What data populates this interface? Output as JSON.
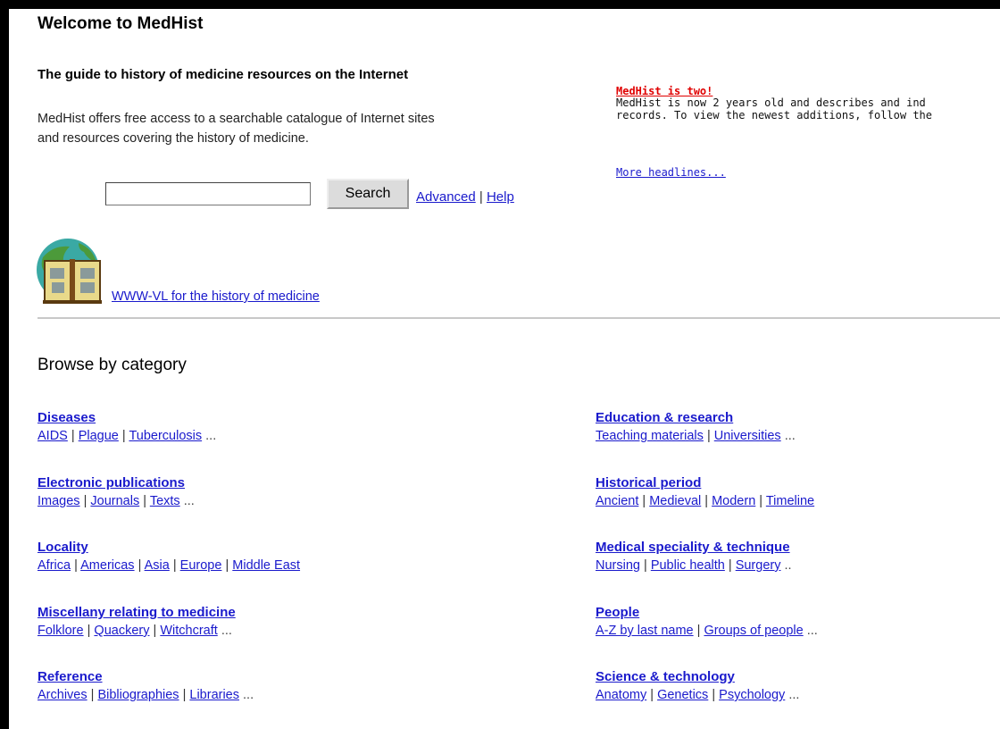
{
  "page": {
    "title": "Welcome to MedHist",
    "tagline": "The guide to history of medicine resources on the Internet",
    "intro_line1": "MedHist offers free access to a searchable catalogue of Internet sites",
    "intro_line2": "and resources covering the history of medicine."
  },
  "search": {
    "value": "",
    "placeholder": "",
    "button_label": "Search",
    "advanced_label": "Advanced",
    "help_label": "Help",
    "separator": "|"
  },
  "vl": {
    "link_label": "WWW-VL for the history of medicine",
    "logo_icon": "open-book-globe-icon"
  },
  "news": {
    "headline": "MedHist is two!",
    "body_line1": "MedHist is now 2 years old and describes and ind",
    "body_line2": "records. To view the newest additions, follow the",
    "more_label": "More headlines..."
  },
  "browse": {
    "title": "Browse by category",
    "separator": "|",
    "ellipsis": "...",
    "short_ellipsis": "..",
    "diseases": {
      "name": "Diseases",
      "subs": [
        "AIDS",
        "Plague",
        "Tuberculosis"
      ]
    },
    "electronic": {
      "name": "Electronic publications",
      "subs": [
        "Images",
        "Journals",
        "Texts"
      ]
    },
    "locality": {
      "name": "Locality",
      "subs": [
        "Africa",
        "Americas",
        "Asia",
        "Europe",
        "Middle East"
      ]
    },
    "misc": {
      "name": "Miscellany relating to medicine",
      "subs": [
        "Folklore",
        "Quackery",
        "Witchcraft"
      ]
    },
    "reference": {
      "name": "Reference",
      "subs": [
        "Archives",
        "Bibliographies",
        "Libraries"
      ]
    },
    "education": {
      "name": "Education & research",
      "subs": [
        "Teaching materials",
        "Universities"
      ]
    },
    "historical": {
      "name": "Historical period",
      "subs": [
        "Ancient",
        "Medieval",
        "Modern",
        "Timeline"
      ]
    },
    "medical": {
      "name": "Medical speciality & technique",
      "subs": [
        "Nursing",
        "Public health",
        "Surgery"
      ]
    },
    "people": {
      "name": "People",
      "subs": [
        "A-Z by last name",
        "Groups of people"
      ]
    },
    "science": {
      "name": "Science & technology",
      "subs": [
        "Anatomy",
        "Genetics",
        "Psychology"
      ]
    }
  },
  "colors": {
    "link": "#1a1acc",
    "headline": "#e00000",
    "frame": "#000000",
    "divider": "#c8c8c8"
  }
}
